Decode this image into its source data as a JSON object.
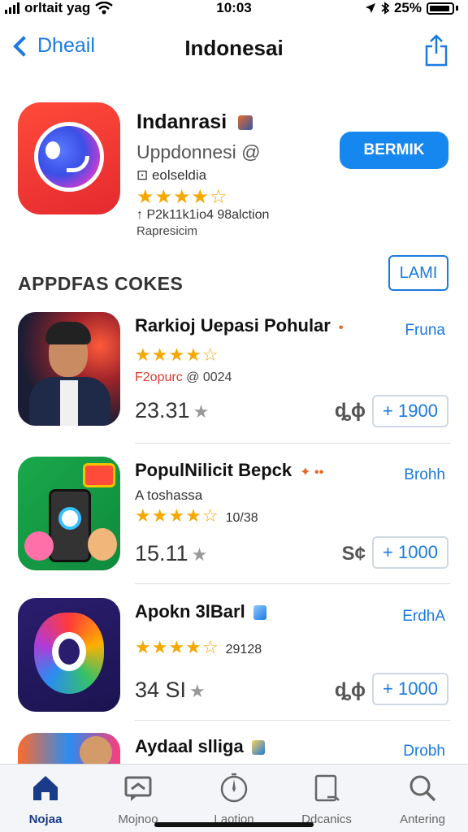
{
  "status": {
    "carrier": "orltait yag",
    "time": "10:03",
    "battery": "25%"
  },
  "nav": {
    "back_label": "Dheail",
    "title": "Indonesai"
  },
  "header_app": {
    "name": "Indanrasi",
    "subtitle": "Uppdonnesi @",
    "developer": "⊡ eolseldia",
    "stars": "★★★★☆",
    "meta": "↑ P2k11k1io4 98alction",
    "meta2": "Rapresicim",
    "get_label": "BERMIK"
  },
  "section": {
    "title": "APPDFAS COKES",
    "see_all_label": "LAMI"
  },
  "apps": [
    {
      "name": "Rarkioj Uepasi Pohular",
      "tag": "Fruna",
      "sub": "",
      "stars": "★★★★☆",
      "count": "",
      "meta_red": "F2opurc",
      "meta": " @ 0024",
      "rating": "23.31",
      "price": "ȡɸ",
      "add_label": "+ 1900"
    },
    {
      "name": "PopulNilicit Bepck",
      "tag": "Brohh",
      "sub": "A toshassa",
      "stars": "★★★★☆",
      "count": "10/38",
      "meta_red": "",
      "meta": "",
      "rating": "15.11",
      "price": "S¢",
      "add_label": "+ 1000"
    },
    {
      "name": "Apokn 3lBarl",
      "tag": "ErdhA",
      "sub": "",
      "stars": "★★★★☆",
      "count": "29128",
      "meta_red": "",
      "meta": "",
      "rating": "34 SI",
      "price": "ȡɸ",
      "add_label": "+ 1000"
    },
    {
      "name": "Aydaal slliga",
      "tag": "Drobh"
    }
  ],
  "tabs": [
    {
      "label": "Nojaa",
      "icon": "home-icon"
    },
    {
      "label": "Mojnoo",
      "icon": "chat-icon"
    },
    {
      "label": "Laotion",
      "icon": "compass-icon"
    },
    {
      "label": "Ddcanics",
      "icon": "document-icon"
    },
    {
      "label": "Antering",
      "icon": "search-icon"
    }
  ],
  "colors": {
    "accent": "#1a7ae0",
    "get_button": "#1787f0",
    "star": "#f5a800"
  }
}
